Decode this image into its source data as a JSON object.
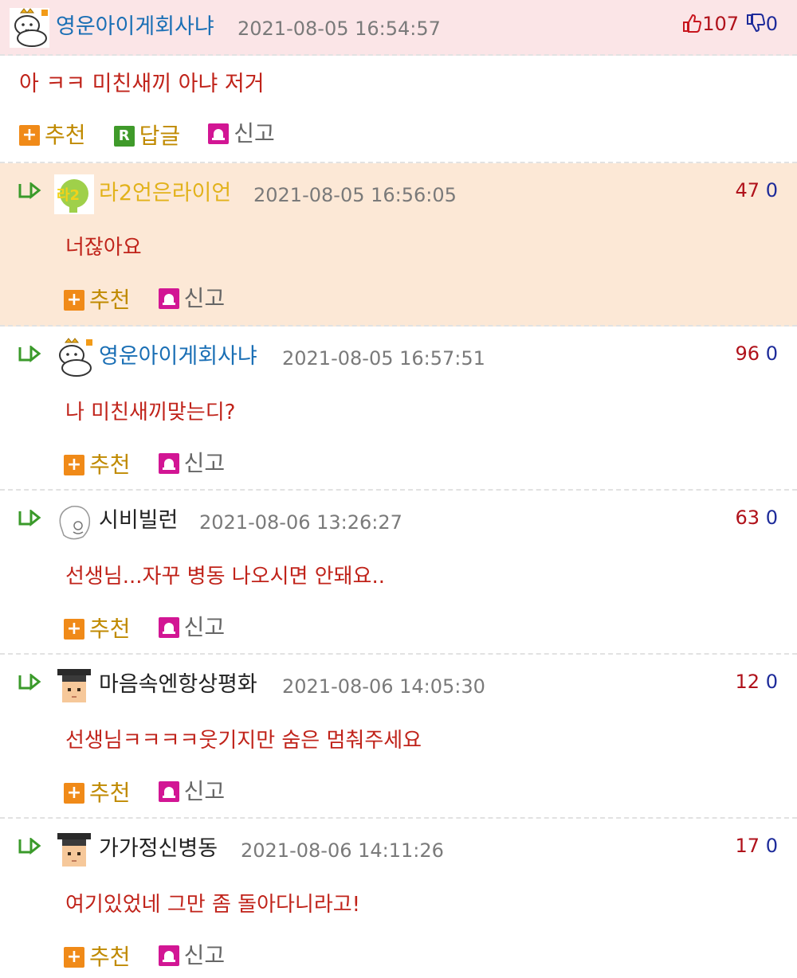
{
  "labels": {
    "recommend": "추천",
    "reply": "답글",
    "report": "신고"
  },
  "colors": {
    "root_bg": "#fbe5e7",
    "highlight_bg": "#fce8d6",
    "up": "#b0121b",
    "down": "#1d2b9a",
    "body_text": "#c0231a"
  },
  "icons": {
    "recommend": "plus-square-icon",
    "reply": "r-square-icon",
    "report": "siren-icon",
    "reply_marker": "reply-arrow-icon",
    "vote_up": "thumbs-up-icon",
    "vote_down": "thumbs-down-icon"
  },
  "comments": [
    {
      "nickname": "영운아이게회사냐",
      "datetime": "2021-08-05 16:54:57",
      "up": "107",
      "down": "0",
      "text": "아 ㅋㅋ 미친새끼 아냐 저거",
      "nick_color": "#1a6fb5",
      "avatar": "cat-king-avatar"
    },
    {
      "nickname": "라2언은라이언",
      "datetime": "2021-08-05 16:56:05",
      "up": "47",
      "down": "0",
      "text": "너잖아요",
      "nick_color": "#e2b21b",
      "avatar": "green-lion-avatar"
    },
    {
      "nickname": "영운아이게회사냐",
      "datetime": "2021-08-05 16:57:51",
      "up": "96",
      "down": "0",
      "text": "나 미친새끼맞는디?",
      "nick_color": "#1a6fb5",
      "avatar": "cat-king-avatar"
    },
    {
      "nickname": "시비빌런",
      "datetime": "2021-08-06 13:26:27",
      "up": "63",
      "down": "0",
      "text": "선생님...자꾸 병동 나오시면 안돼요..",
      "nick_color": "#222222",
      "avatar": "sketch-face-avatar"
    },
    {
      "nickname": "마음속엔항상평화",
      "datetime": "2021-08-06 14:05:30",
      "up": "12",
      "down": "0",
      "text": "선생님ㅋㅋㅋㅋ웃기지만 숨은 멈춰주세요",
      "nick_color": "#222222",
      "avatar": "graduate-avatar"
    },
    {
      "nickname": "가가정신병동",
      "datetime": "2021-08-06 14:11:26",
      "up": "17",
      "down": "0",
      "text": "여기있었네 그만 좀 돌아다니라고!",
      "nick_color": "#222222",
      "avatar": "graduate-avatar"
    }
  ]
}
